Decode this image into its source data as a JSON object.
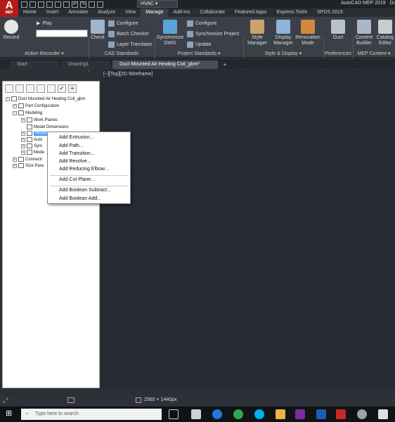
{
  "app": {
    "logo_text": "A",
    "logo_sub": "MEP",
    "workspace": "HVAC",
    "title": "AutoCAD MEP 2019",
    "title_trailing": "Du"
  },
  "ribbon_tabs": [
    "Home",
    "Insert",
    "Annotate",
    "Analyze",
    "View",
    "Manage",
    "Add-ins",
    "Collaborate",
    "Featured Apps",
    "Express Tools",
    "SPDS 2019"
  ],
  "active_ribbon_tab": "Manage",
  "ribbon": {
    "record": "Record",
    "play": "Play",
    "check": "Check",
    "configure": "Configure",
    "batch_checker": "Batch Checker",
    "layer_translator": "Layer Translator",
    "synchronize_dwg": "Synchronize DWG",
    "configure2": "Configure",
    "synchronize_project": "Synchronize Project",
    "update": "Update",
    "style_manager": "Style Manager",
    "display_manager": "Display Manager",
    "renovation_mode": "Renovation Mode",
    "duct": "Duct",
    "content_builder": "Content Builder",
    "catalog_editor": "Catalog Editor",
    "panels": {
      "action_recorder": "Action Recorder ▾",
      "cad_standards": "CAD Standards",
      "project_standards": "Project Standards ▾",
      "style_display": "Style & Display ▾",
      "preferences": "Preferences",
      "mep_content": "MEP Content ▾"
    }
  },
  "doc_tabs": [
    "Start",
    "Drawing1",
    "Duct Mounted Air Heating Coil_gbm*"
  ],
  "active_doc_tab": 2,
  "tree": {
    "root": "Duct Mounted Air Heating Coil_gbm",
    "part_configuration": "Part Configuration",
    "modeling": "Modeling",
    "work_planes": "Work Planes",
    "model_dimensions": "Model Dimensions",
    "modifiers": "Modifiers",
    "auto": "Auto",
    "sym": "Sym",
    "mode": "Mode",
    "connectors": "Connecti",
    "size_parameters": "Size Para"
  },
  "viewport": {
    "label": "[−][Top][2D Wireframe]"
  },
  "context_menu": [
    "Add Extrusion...",
    "Add Path...",
    "Add Transition...",
    "Add Revolve...",
    "Add Reducing Elbow...",
    "Add Cut Plane...",
    "Add Boolean Subtract...",
    "Add Boolean Add..."
  ],
  "status": {
    "resolution": "2560 × 1440px"
  },
  "taskbar": {
    "search_placeholder": "Type here to search"
  },
  "colors": {
    "accent": "#3399ff",
    "logo": "#b31b1b",
    "ribbon": "#3b4048",
    "viewport": "#262a33"
  }
}
